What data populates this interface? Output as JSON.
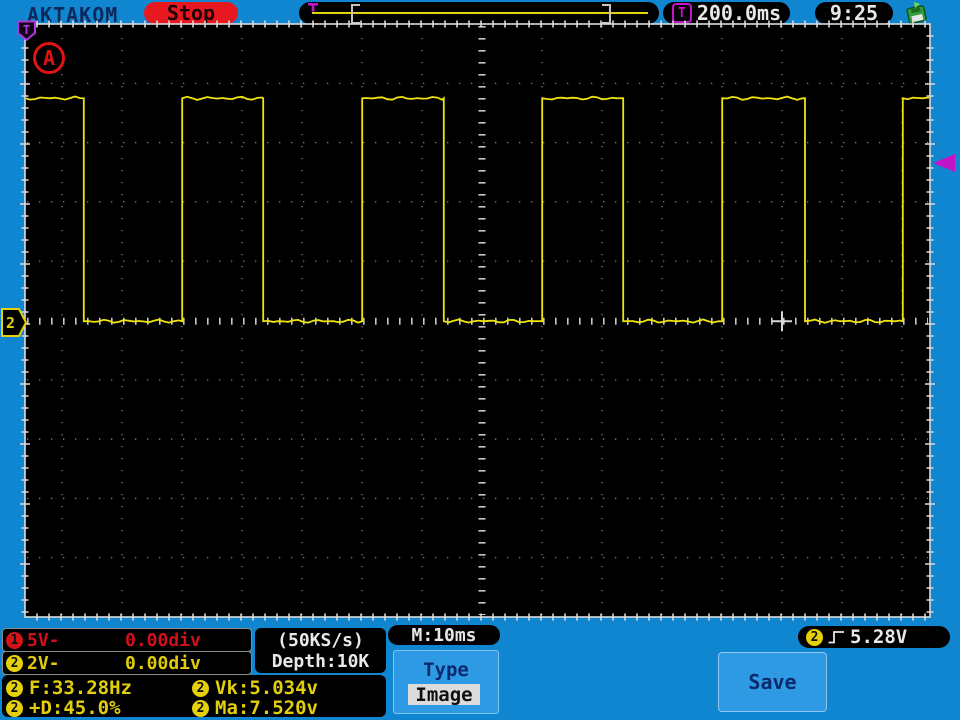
{
  "topbar": {
    "brand": "AKTAKOM",
    "stop_label": "Stop",
    "trigger_time": "200.0ms",
    "trigger_badge": "T",
    "clock": "9:25"
  },
  "screen": {
    "mode_label": "A",
    "ch2_marker": "2",
    "trigger_flag": "T"
  },
  "footer": {
    "ch1": {
      "num": "1",
      "scale": "5V-",
      "offset": "0.00div"
    },
    "ch2": {
      "num": "2",
      "scale": "2V-",
      "offset": "0.00div"
    },
    "sampling": {
      "rate": "(50KS/s)",
      "depth": "Depth:10K"
    },
    "timebase": "M:10ms",
    "menu": {
      "title": "Type",
      "selected": "Image"
    },
    "save_label": "Save",
    "trigger": {
      "ch": "2",
      "level": "5.28V"
    },
    "meas_badge": "2",
    "measurements": {
      "f": "F:33.28Hz",
      "duty": "+D:45.0%",
      "vk": "Vk:5.034v",
      "ma": "Ma:7.520v"
    }
  },
  "chart_data": {
    "type": "line",
    "waveform": "square",
    "title": "CH2 square wave",
    "x_unit": "ms",
    "y_unit": "V",
    "time_per_div_ms": 10,
    "volts_per_div": 2,
    "frequency_hz": 33.28,
    "duty_cycle_pct": 45.0,
    "amplitude_v": 7.52,
    "low_v": 0,
    "high_v": 7.52,
    "t_range_ms": [
      0,
      151
    ],
    "start_level": "high",
    "edges_ms": {
      "falls": [
        9.8,
        39.7,
        69.8,
        99.7,
        130.0
      ],
      "rises": [
        26.2,
        56.2,
        86.2,
        116.2,
        146.3
      ]
    },
    "grid": {
      "h_divs_visible": 15,
      "v_divs_visible": 10,
      "style": "dotted"
    }
  }
}
